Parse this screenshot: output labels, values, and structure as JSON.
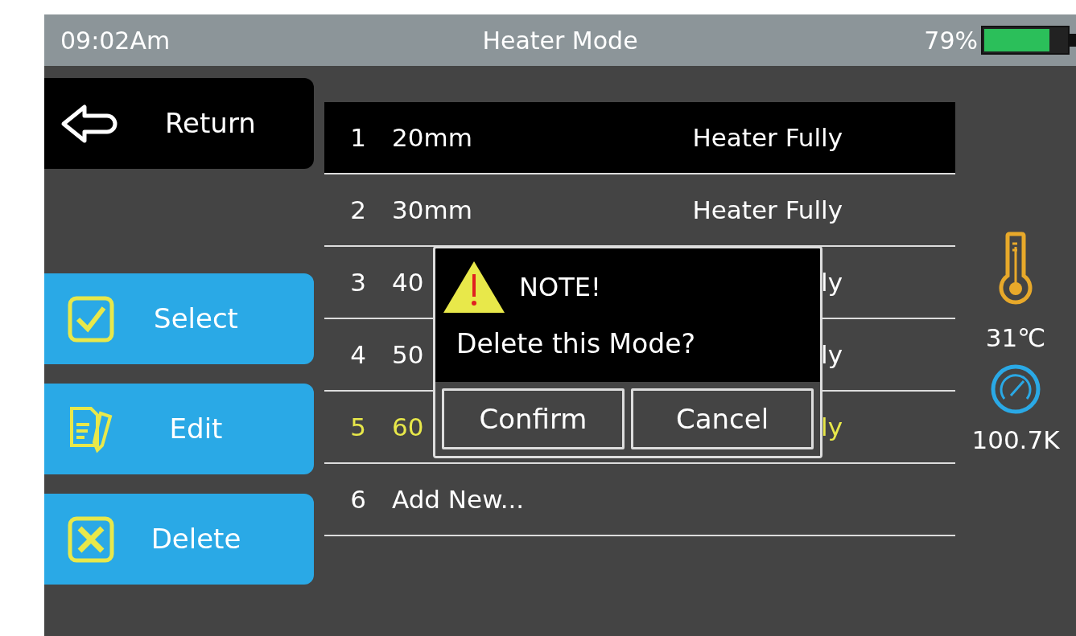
{
  "status_bar": {
    "time": "09:02Am",
    "title": "Heater Mode",
    "battery_text": "79%"
  },
  "sidebar": {
    "return_label": "Return",
    "actions": [
      {
        "kind": "select",
        "label": "Select"
      },
      {
        "kind": "edit",
        "label": "Edit"
      },
      {
        "kind": "delete",
        "label": "Delete"
      }
    ]
  },
  "modes": [
    {
      "number": "1",
      "name": "20mm",
      "status": "Heater Fully",
      "highlighted": true,
      "selected": false
    },
    {
      "number": "2",
      "name": "30mm",
      "status": "Heater Fully",
      "highlighted": false,
      "selected": false
    },
    {
      "number": "3",
      "name": "40",
      "status": "ly",
      "highlighted": false,
      "selected": false
    },
    {
      "number": "4",
      "name": "50",
      "status": "ly",
      "highlighted": false,
      "selected": false
    },
    {
      "number": "5",
      "name": "60",
      "status": "ly",
      "highlighted": false,
      "selected": true
    },
    {
      "number": "6",
      "name": "Add New...",
      "highlighted": false,
      "selected": false
    }
  ],
  "readings": {
    "temperature": "31℃",
    "pressure": "100.7K"
  },
  "dialog": {
    "title": "NOTE!",
    "message": "Delete this Mode?",
    "buttons": [
      "Confirm",
      "Cancel"
    ]
  }
}
